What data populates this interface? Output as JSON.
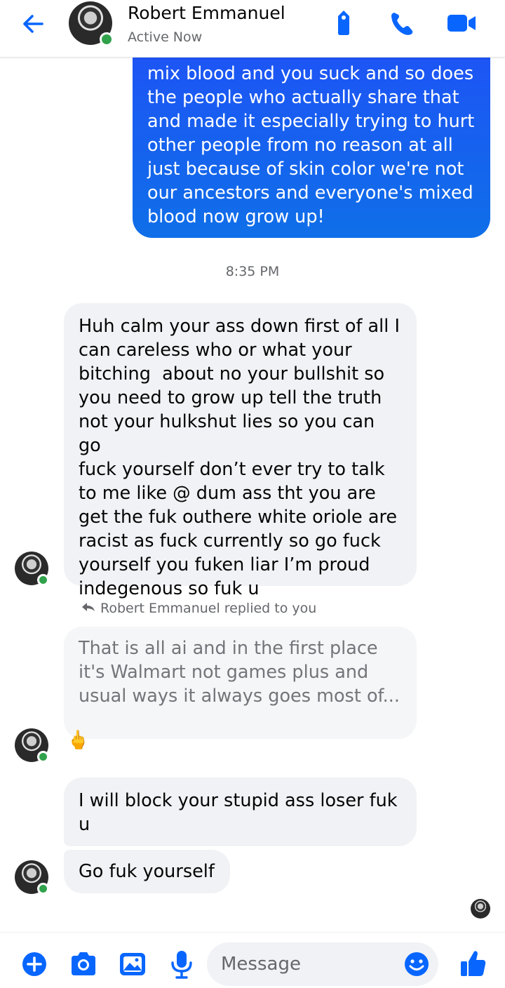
{
  "header": {
    "contact_name": "Robert Emmanuel",
    "status": "Active Now"
  },
  "messages": {
    "sent_1": "mix blood and you suck and so does\nthe people who actually share that\nand made it especially trying to hurt\nother people from no reason at all\njust because of skin color we're not\nour ancestors and everyone's mixed\nblood now grow up!",
    "timestamp": "8:35 PM",
    "received_1": "Huh calm your ass down first of all I\ncan careless who or what your\nbitching  about no your bullshit so\nyou need to grow up tell the truth\nnot your hulkshut lies so you can go\nfuck yourself don’t ever try to talk\nto me like @ dum ass tht you are\nget the fuk outhere white oriole are\nracist as fuck currently so go fuck\nyourself you fuken liar I’m proud\nindegenous so fuk u",
    "reply_label": "Robert Emmanuel replied to you",
    "quoted": "That is all ai and in the first place\nit's Walmart not games plus and\nusual ways it always goes most of...",
    "reaction_emoji": "🖕",
    "received_2": "I will block your stupid ass loser fuk\nu",
    "received_3": "Go fuk yourself"
  },
  "composer": {
    "placeholder": "Message"
  },
  "colors": {
    "accent": "#0866ff",
    "sent_bubble": "#1a63f0",
    "received_bubble": "#f0f2f5",
    "online_dot": "#31a24c"
  },
  "icons": [
    "back-arrow-icon",
    "tag-icon",
    "phone-icon",
    "video-icon",
    "plus-icon",
    "camera-icon",
    "image-icon",
    "microphone-icon",
    "emoji-icon",
    "thumbs-up-icon"
  ]
}
